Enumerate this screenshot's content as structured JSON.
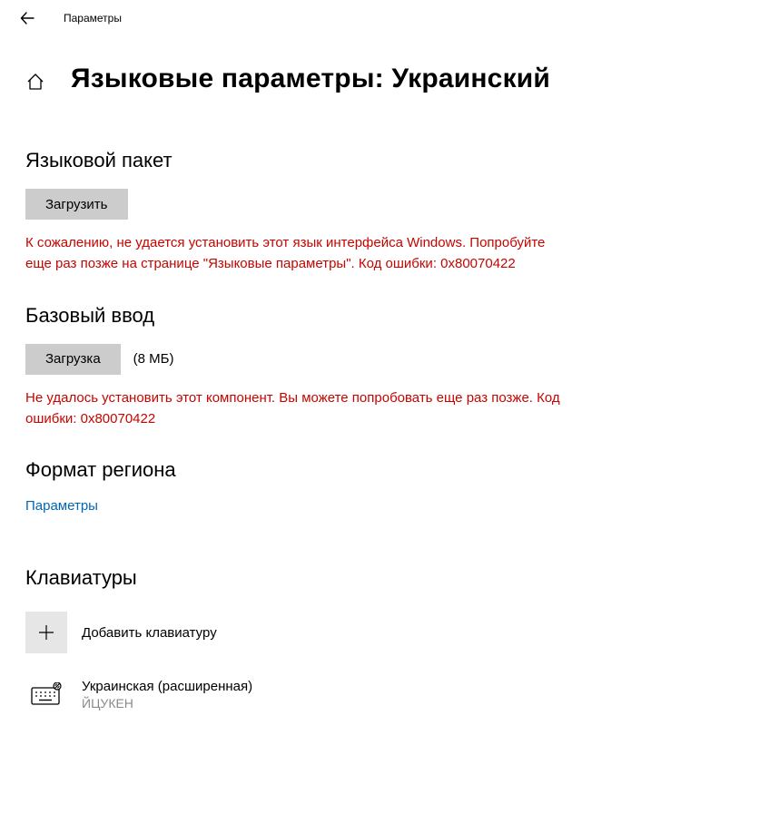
{
  "titlebar": {
    "app_name": "Параметры"
  },
  "page": {
    "title": "Языковые параметры: Украинский"
  },
  "language_pack": {
    "heading": "Языковой пакет",
    "download_label": "Загрузить",
    "error": "К сожалению, не удается установить этот язык интерфейса Windows. Попробуйте еще раз позже на странице \"Языковые параметры\". Код ошибки: 0x80070422"
  },
  "basic_input": {
    "heading": "Базовый ввод",
    "downloading_label": "Загрузка",
    "size": "(8 МБ)",
    "error": "Не удалось установить этот компонент. Вы можете попробовать еще раз позже. Код ошибки: 0x80070422"
  },
  "region_format": {
    "heading": "Формат региона",
    "link_label": "Параметры"
  },
  "keyboards": {
    "heading": "Клавиатуры",
    "add_label": "Добавить клавиатуру",
    "items": [
      {
        "name": "Украинская (расширенная)",
        "layout": "ЙЦУКЕН"
      }
    ]
  }
}
